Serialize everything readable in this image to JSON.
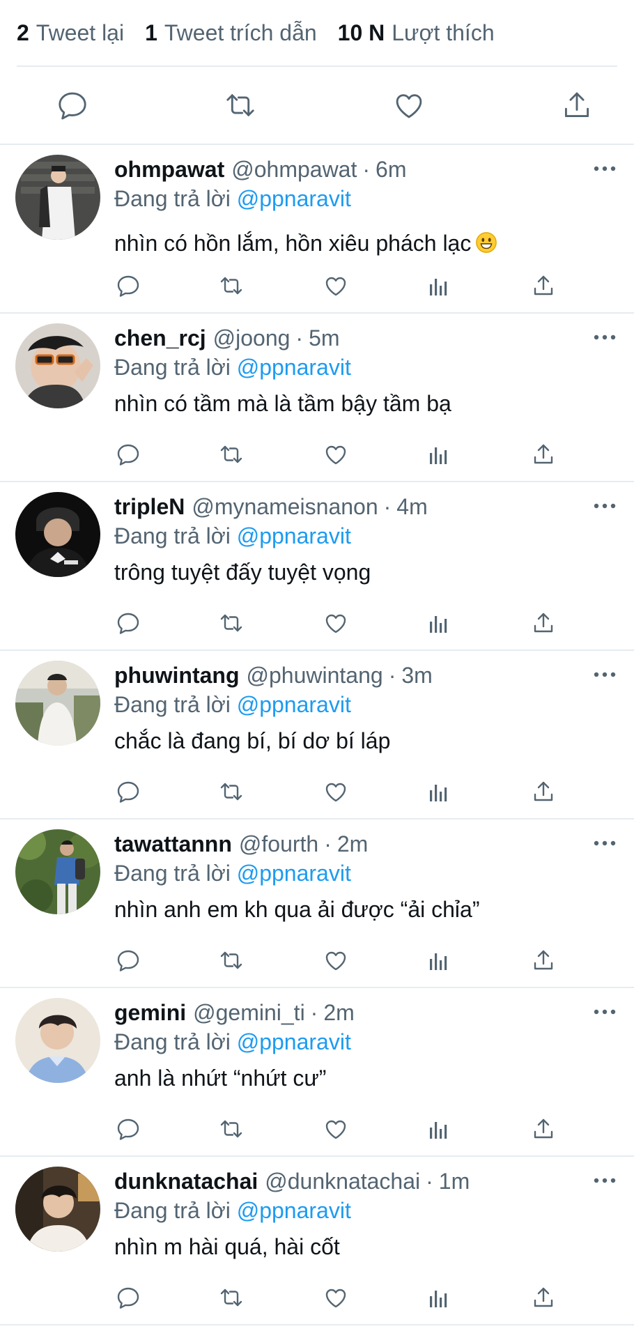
{
  "stats": [
    {
      "number": "2",
      "label": "Tweet lại"
    },
    {
      "number": "1",
      "label": "Tweet trích dẫn"
    },
    {
      "number": "10 N",
      "label": "Lượt thích"
    }
  ],
  "main_actions": [
    "reply-icon",
    "retweet-icon",
    "like-icon",
    "share-icon"
  ],
  "reply_actions": [
    "reply-icon",
    "retweet-icon",
    "like-icon",
    "analytics-icon",
    "share-icon"
  ],
  "colors": {
    "text": "#0f1419",
    "muted": "#536471",
    "link": "#1d9bf0",
    "divider": "#e6ecf0"
  },
  "replies": [
    {
      "name": "ohmpawat",
      "handle": "@ohmpawat",
      "sep": "·",
      "time": "6m",
      "replying_label": "Đang trả lời",
      "mention": "@ppnaravit",
      "text": "nhìn có hồn lắm, hồn xiêu phách lạc",
      "emoji": "grinning-face-emoji"
    },
    {
      "name": "chen_rcj",
      "handle": "@joong",
      "sep": "·",
      "time": "5m",
      "replying_label": "Đang trả lời",
      "mention": "@ppnaravit",
      "text": "nhìn có tầm mà là tầm bậy tầm bạ"
    },
    {
      "name": "tripleN",
      "handle": "@mynameisnanon",
      "sep": "·",
      "time": "4m",
      "replying_label": "Đang trả lời",
      "mention": "@ppnaravit",
      "text": "trông tuyệt đấy tuyệt vọng"
    },
    {
      "name": "phuwintang",
      "handle": "@phuwintang",
      "sep": "·",
      "time": "3m",
      "replying_label": "Đang trả lời",
      "mention": "@ppnaravit",
      "text": "chắc là đang bí, bí dơ bí láp"
    },
    {
      "name": "tawattannn",
      "handle": "@fourth",
      "sep": "·",
      "time": "2m",
      "replying_label": "Đang trả lời",
      "mention": "@ppnaravit",
      "text": "nhìn anh em kh qua ải được “ải chỉa”"
    },
    {
      "name": "gemini",
      "handle": "@gemini_ti",
      "sep": "·",
      "time": "2m",
      "replying_label": "Đang trả lời",
      "mention": "@ppnaravit",
      "text": "anh là nhứt “nhứt cư”"
    },
    {
      "name": "dunknatachai",
      "handle": "@dunknatachai",
      "sep": "·",
      "time": "1m",
      "replying_label": "Đang trả lời",
      "mention": "@ppnaravit",
      "text": "nhìn m hài quá, hài cốt"
    }
  ]
}
